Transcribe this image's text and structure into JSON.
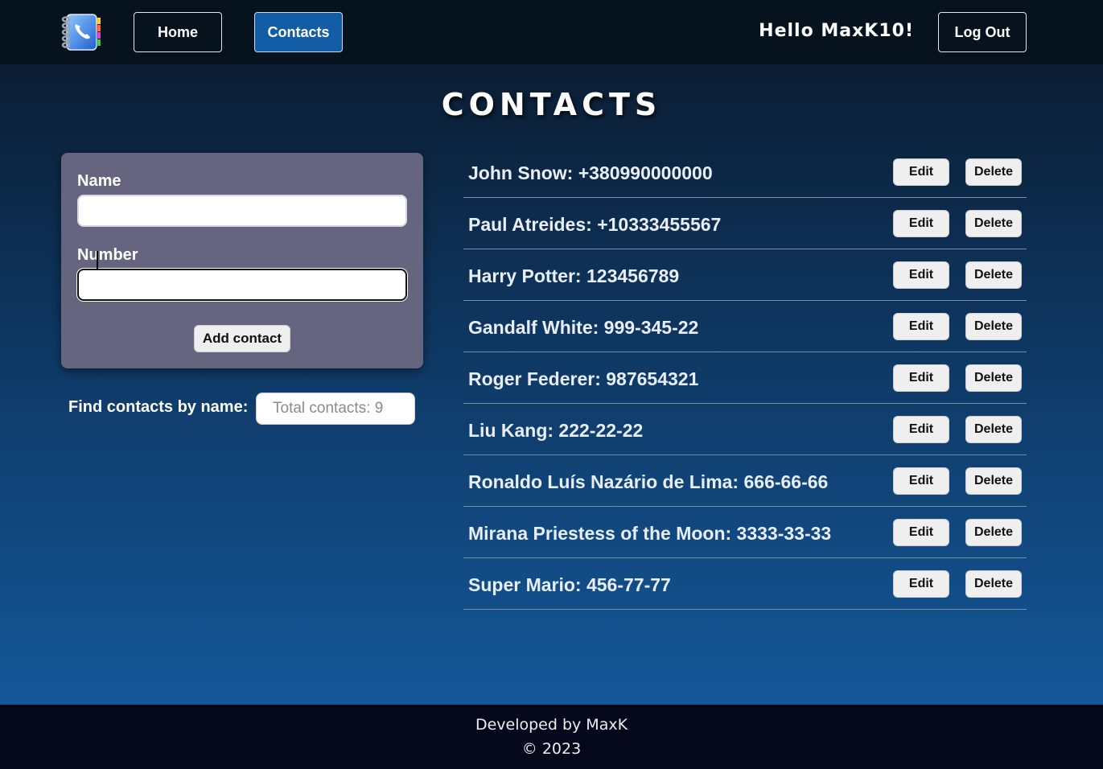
{
  "header": {
    "logo_icon": "contacts-book-icon",
    "nav": {
      "home_label": "Home",
      "contacts_label": "Contacts"
    },
    "greeting": "Hello MaxK10!",
    "logout_label": "Log Out"
  },
  "main": {
    "title": "CONTACTS",
    "form": {
      "name_label": "Name",
      "name_value": "",
      "number_label": "Number",
      "number_value": "",
      "submit_label": "Add contact"
    },
    "filter": {
      "label": "Find contacts by name:",
      "placeholder": "Total contacts: 9",
      "value": ""
    },
    "contacts": [
      {
        "text": "John Snow: +380990000000",
        "edit_label": "Edit",
        "delete_label": "Delete"
      },
      {
        "text": "Paul Atreides: +10333455567",
        "edit_label": "Edit",
        "delete_label": "Delete"
      },
      {
        "text": "Harry Potter: 123456789",
        "edit_label": "Edit",
        "delete_label": "Delete"
      },
      {
        "text": "Gandalf White: 999-345-22",
        "edit_label": "Edit",
        "delete_label": "Delete"
      },
      {
        "text": "Roger Federer: 987654321",
        "edit_label": "Edit",
        "delete_label": "Delete"
      },
      {
        "text": "Liu Kang: 222-22-22",
        "edit_label": "Edit",
        "delete_label": "Delete"
      },
      {
        "text": "Ronaldo Luís Nazário de Lima: 666-66-66",
        "edit_label": "Edit",
        "delete_label": "Delete"
      },
      {
        "text": "Mirana Priestess of the Moon: 3333-33-33",
        "edit_label": "Edit",
        "delete_label": "Delete"
      },
      {
        "text": "Super Mario: 456-77-77",
        "edit_label": "Edit",
        "delete_label": "Delete"
      }
    ]
  },
  "footer": {
    "line1": "Developed by MaxK",
    "line2": "© 2023"
  },
  "colors": {
    "header_bg": "#07121f",
    "active_nav": "#135da6",
    "form_card": "#65657f",
    "footer_bg": "#05071a"
  }
}
